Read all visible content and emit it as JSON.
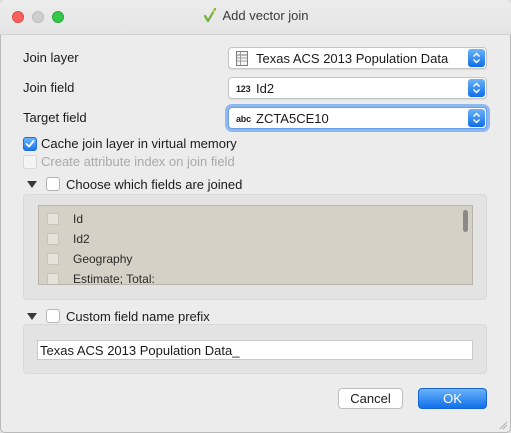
{
  "window": {
    "title": "Add vector join",
    "title_icon": "join-pencil-icon"
  },
  "form": {
    "join_layer": {
      "label": "Join layer",
      "value": "Texas ACS 2013 Population Data",
      "icon": "table-icon"
    },
    "join_field": {
      "label": "Join field",
      "value": "Id2",
      "type_tag": "123"
    },
    "target_field": {
      "label": "Target field",
      "value": "ZCTA5CE10",
      "type_tag": "abc"
    },
    "cache_checkbox": {
      "label": "Cache join layer in virtual memory",
      "checked": true
    },
    "index_checkbox": {
      "label": "Create attribute index on join field",
      "checked": false,
      "enabled": false
    }
  },
  "fields_group": {
    "label": "Choose which fields are joined",
    "checked": false,
    "fields": [
      "Id",
      "Id2",
      "Geography",
      "Estimate; Total:"
    ]
  },
  "prefix_group": {
    "label": "Custom field name prefix",
    "checked": false,
    "value": "Texas ACS 2013 Population Data_"
  },
  "buttons": {
    "cancel": "Cancel",
    "ok": "OK"
  },
  "colors": {
    "accent": "#1a78ee",
    "close": "#fc605c",
    "maximize": "#34c84a"
  }
}
